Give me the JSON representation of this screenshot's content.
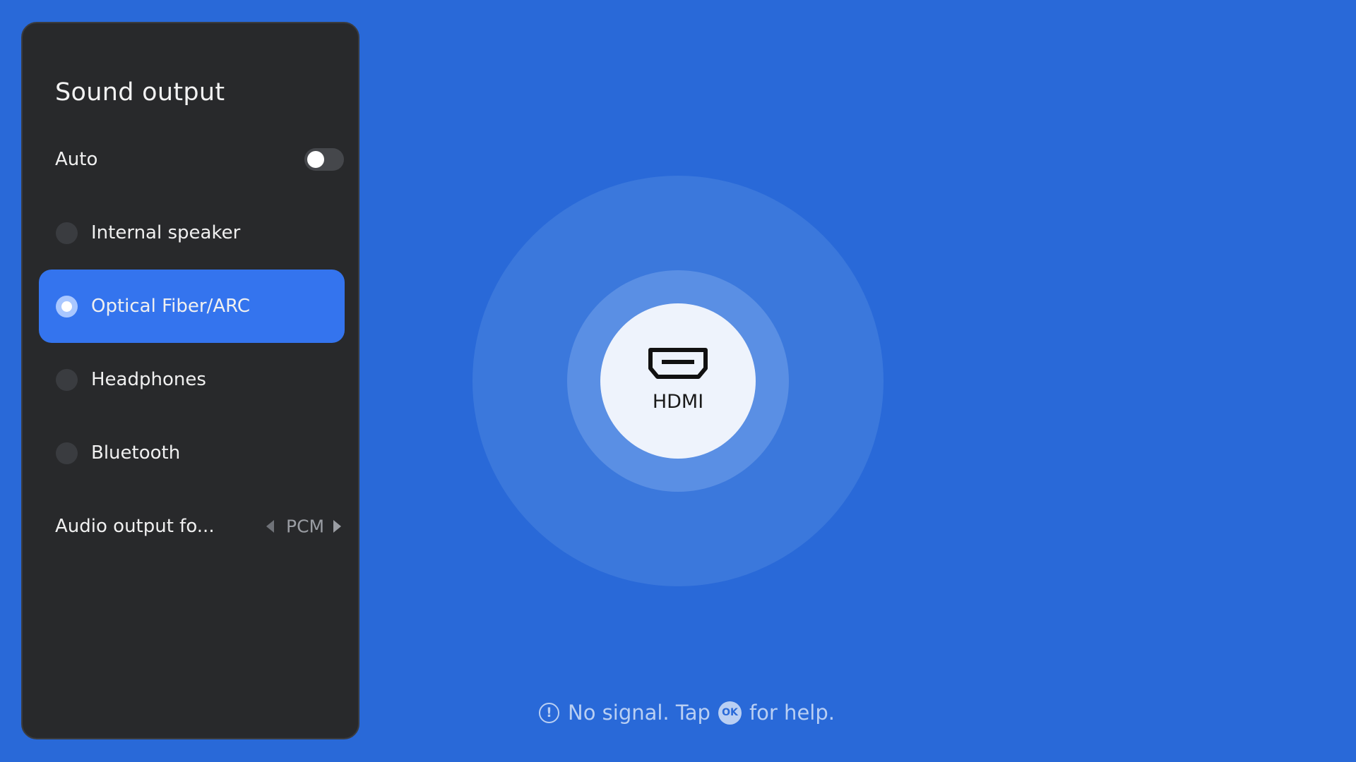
{
  "panel": {
    "title": "Sound output",
    "auto": {
      "label": "Auto",
      "enabled": false
    },
    "outputs": [
      {
        "label": "Internal speaker",
        "selected": false
      },
      {
        "label": "Optical Fiber/ARC",
        "selected": true
      },
      {
        "label": "Headphones",
        "selected": false
      },
      {
        "label": "Bluetooth",
        "selected": false
      }
    ],
    "audio_format": {
      "label": "Audio output fo...",
      "value": "PCM"
    }
  },
  "source": {
    "label": "HDMI",
    "icon": "hdmi-port-icon"
  },
  "hint": {
    "icon": "info-circle-icon",
    "text_before": "No signal. Tap",
    "ok_key": "OK",
    "text_after": "for help."
  },
  "colors": {
    "background": "#2969d8",
    "panel": "#28292b",
    "selected_row": "#3474ee",
    "hint_text": "#b9cff3"
  }
}
